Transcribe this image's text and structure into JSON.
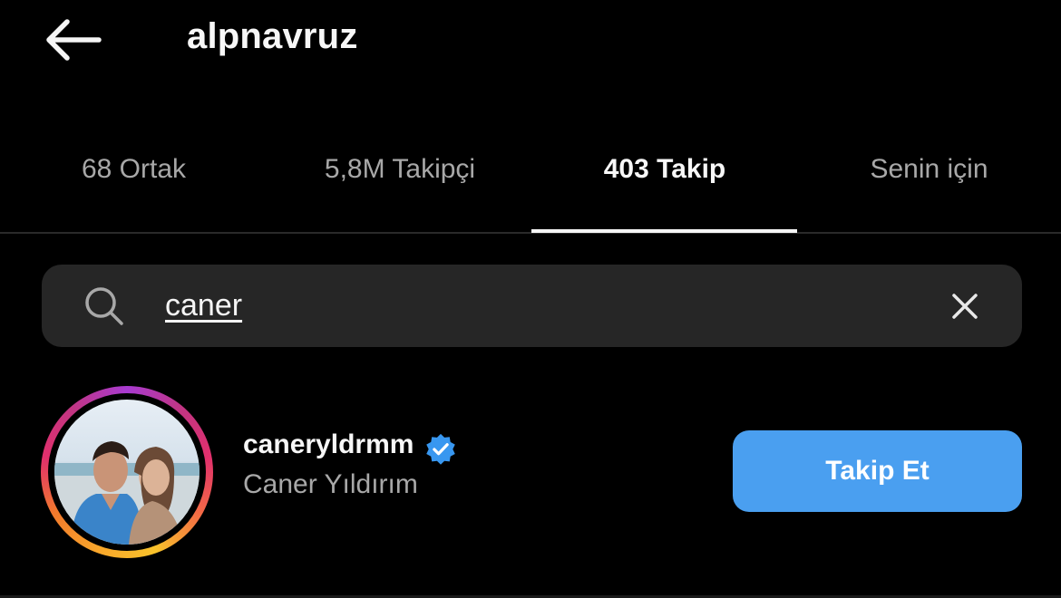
{
  "header": {
    "title": "alpnavruz",
    "back_icon": "arrow-left-icon"
  },
  "tabs": [
    {
      "label": "68 Ortak",
      "active": false
    },
    {
      "label": "5,8M Takipçi",
      "active": false
    },
    {
      "label": "403 Takip",
      "active": true
    },
    {
      "label": "Senin için",
      "active": false
    }
  ],
  "search": {
    "value": "caner",
    "icon": "search-icon",
    "clear_icon": "close-icon"
  },
  "results": [
    {
      "username": "caneryldrmm",
      "full_name": "Caner Yıldırım",
      "verified": true,
      "button_label": "Takip Et"
    }
  ],
  "colors": {
    "background": "#000000",
    "primary_button": "#4a9ff0",
    "verified_badge": "#3897f0",
    "search_background": "#262626",
    "secondary_text": "#a8a8a8"
  }
}
